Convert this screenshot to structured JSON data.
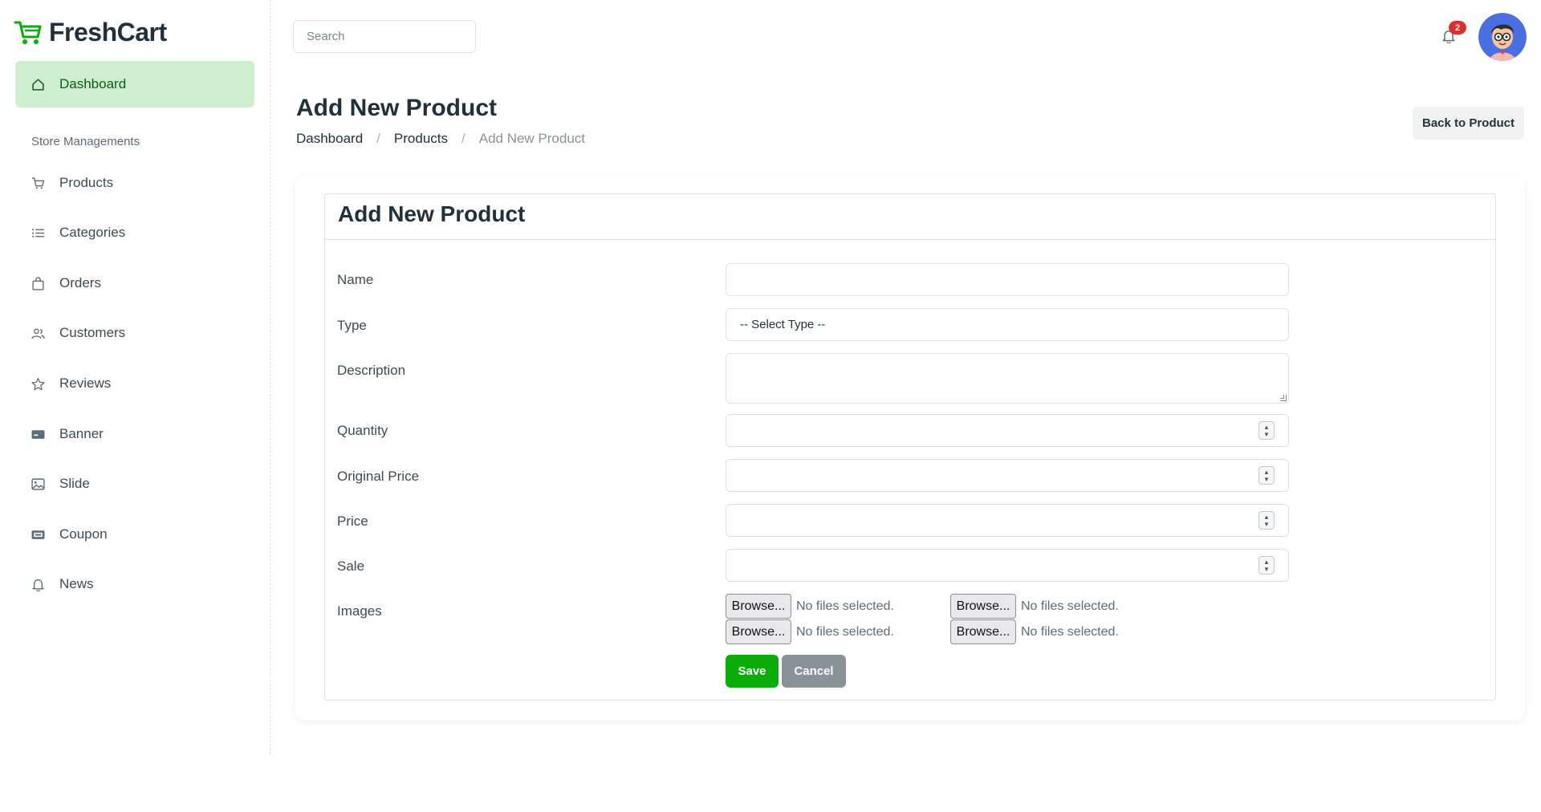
{
  "brand": {
    "name": "FreshCart",
    "icon": "cart-logo-icon",
    "color": "#0aad0a"
  },
  "search": {
    "placeholder": "Search",
    "value": ""
  },
  "notifications": {
    "count": "2",
    "icon": "bell-icon"
  },
  "user": {
    "avatar": "avatar"
  },
  "sidebar": {
    "active": {
      "label": "Dashboard",
      "icon": "home-icon"
    },
    "section_heading": "Store Managements",
    "items": [
      {
        "label": "Products",
        "icon": "cart-icon"
      },
      {
        "label": "Categories",
        "icon": "list-icon"
      },
      {
        "label": "Orders",
        "icon": "bag-icon"
      },
      {
        "label": "Customers",
        "icon": "users-icon"
      },
      {
        "label": "Reviews",
        "icon": "star-icon"
      },
      {
        "label": "Banner",
        "icon": "card-icon"
      },
      {
        "label": "Slide",
        "icon": "image-icon"
      },
      {
        "label": "Coupon",
        "icon": "ticket-icon"
      },
      {
        "label": "News",
        "icon": "bell-icon"
      }
    ]
  },
  "header": {
    "title": "Add New Product",
    "breadcrumb": [
      "Dashboard",
      "Products",
      "Add New Product"
    ],
    "back_label": "Back to Product"
  },
  "form": {
    "title": "Add New Product",
    "labels": {
      "name": "Name",
      "type": "Type",
      "description": "Description",
      "quantity": "Quantity",
      "original_price": "Original Price",
      "price": "Price",
      "sale": "Sale",
      "images": "Images"
    },
    "type_selected": "-- Select Type --",
    "file_inputs": [
      {
        "button": "Browse...",
        "status": "No files selected."
      },
      {
        "button": "Browse...",
        "status": "No files selected."
      },
      {
        "button": "Browse...",
        "status": "No files selected."
      },
      {
        "button": "Browse...",
        "status": "No files selected."
      }
    ],
    "save_label": "Save",
    "cancel_label": "Cancel"
  }
}
